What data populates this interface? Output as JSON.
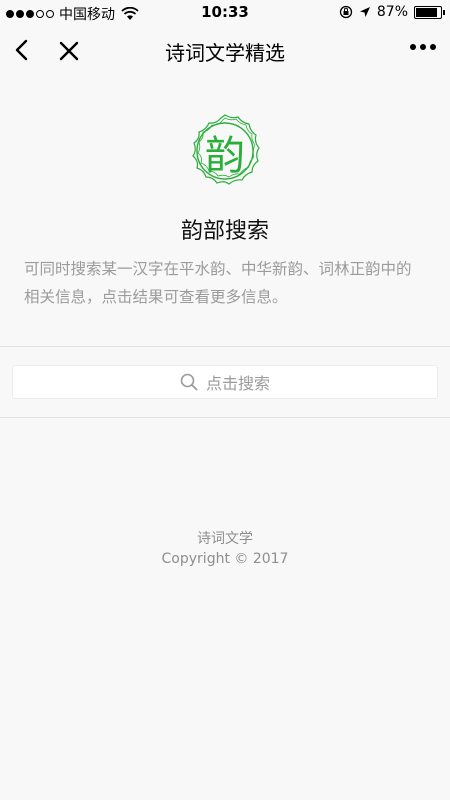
{
  "status_bar": {
    "carrier": "中国移动",
    "time": "10:33",
    "battery_text": "87%",
    "battery_level": 0.87
  },
  "nav": {
    "title": "诗词文学精选"
  },
  "logo": {
    "char": "韵",
    "color": "#2aae3a"
  },
  "main": {
    "title": "韵部搜索",
    "description": "可同时搜索某一汉字在平水韵、中华新韵、词林正韵中的相关信息，点击结果可查看更多信息。"
  },
  "search": {
    "placeholder": "点击搜索"
  },
  "footer": {
    "name": "诗词文学",
    "copyright": "Copyright © 2017"
  }
}
